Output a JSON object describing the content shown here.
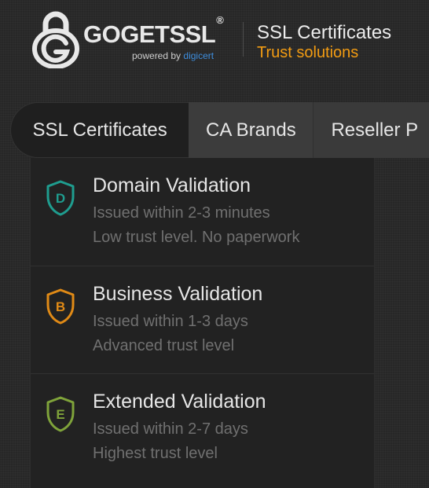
{
  "header": {
    "logo_text_part1": "GOGET",
    "logo_text_part2": "SSL",
    "logo_reg": "®",
    "powered_by": "powered by",
    "powered_brand": "digicert",
    "tagline_title": "SSL Certificates",
    "tagline_subtitle": "Trust solutions"
  },
  "nav": {
    "tabs": [
      {
        "label": "SSL Certificates",
        "active": true
      },
      {
        "label": "CA Brands",
        "active": false
      },
      {
        "label": "Reseller P",
        "active": false
      }
    ]
  },
  "dropdown": {
    "items": [
      {
        "badge": "D",
        "title": "Domain Validation",
        "line1": "Issued within 2-3 minutes",
        "line2": "Low trust level. No paperwork",
        "color": "#1f9d8f"
      },
      {
        "badge": "B",
        "title": "Business Validation",
        "line1": "Issued within 1-3 days",
        "line2": "Advanced trust level",
        "color": "#e08a16"
      },
      {
        "badge": "E",
        "title": "Extended Validation",
        "line1": "Issued within 2-7 days",
        "line2": "Highest trust level",
        "color": "#7fa33a"
      }
    ]
  },
  "colors": {
    "accent_orange": "#f39c12",
    "digicert_blue": "#3e8ede",
    "background": "#272727"
  }
}
